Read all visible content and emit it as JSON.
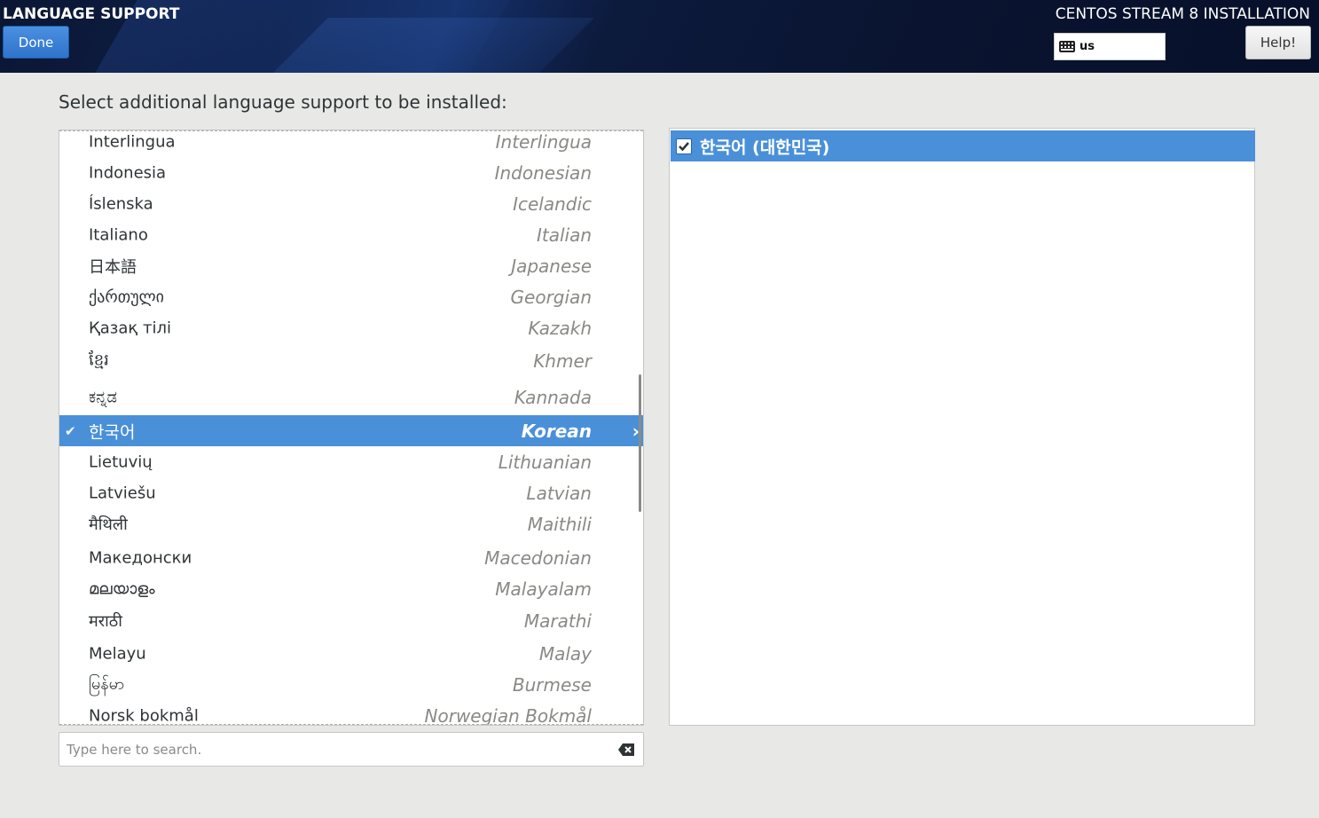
{
  "header": {
    "spoke_title": "LANGUAGE SUPPORT",
    "done_label": "Done",
    "product_title": "CENTOS STREAM 8 INSTALLATION",
    "keyboard_layout": "us",
    "help_label": "Help!"
  },
  "prompt": "Select additional language support to be installed:",
  "languages": [
    {
      "native": "Interlingua",
      "english": "Interlingua"
    },
    {
      "native": "Indonesia",
      "english": "Indonesian"
    },
    {
      "native": "Íslenska",
      "english": "Icelandic"
    },
    {
      "native": "Italiano",
      "english": "Italian"
    },
    {
      "native": "日本語",
      "english": "Japanese"
    },
    {
      "native": "ქართული",
      "english": "Georgian"
    },
    {
      "native": "Қазақ тілі",
      "english": "Kazakh"
    },
    {
      "native": "ខ្មែរ",
      "english": "Khmer"
    },
    {
      "native": "ಕನ್ನಡ",
      "english": "Kannada"
    },
    {
      "native": "한국어",
      "english": "Korean",
      "selected": true,
      "checked": true
    },
    {
      "native": "Lietuvių",
      "english": "Lithuanian"
    },
    {
      "native": "Latviešu",
      "english": "Latvian"
    },
    {
      "native": "मैथिली",
      "english": "Maithili"
    },
    {
      "native": "Македонски",
      "english": "Macedonian"
    },
    {
      "native": "മലയാളം",
      "english": "Malayalam"
    },
    {
      "native": "मराठी",
      "english": "Marathi"
    },
    {
      "native": "Melayu",
      "english": "Malay"
    },
    {
      "native": "မြန်မာ",
      "english": "Burmese"
    },
    {
      "native": "Norsk bokmål",
      "english": "Norwegian Bokmål"
    }
  ],
  "search": {
    "placeholder": "Type here to search.",
    "value": ""
  },
  "locales": [
    {
      "label": "한국어 (대한민국)",
      "checked": true
    }
  ],
  "colors": {
    "accent": "#4a90d9",
    "header_bg": "#0a1430"
  }
}
